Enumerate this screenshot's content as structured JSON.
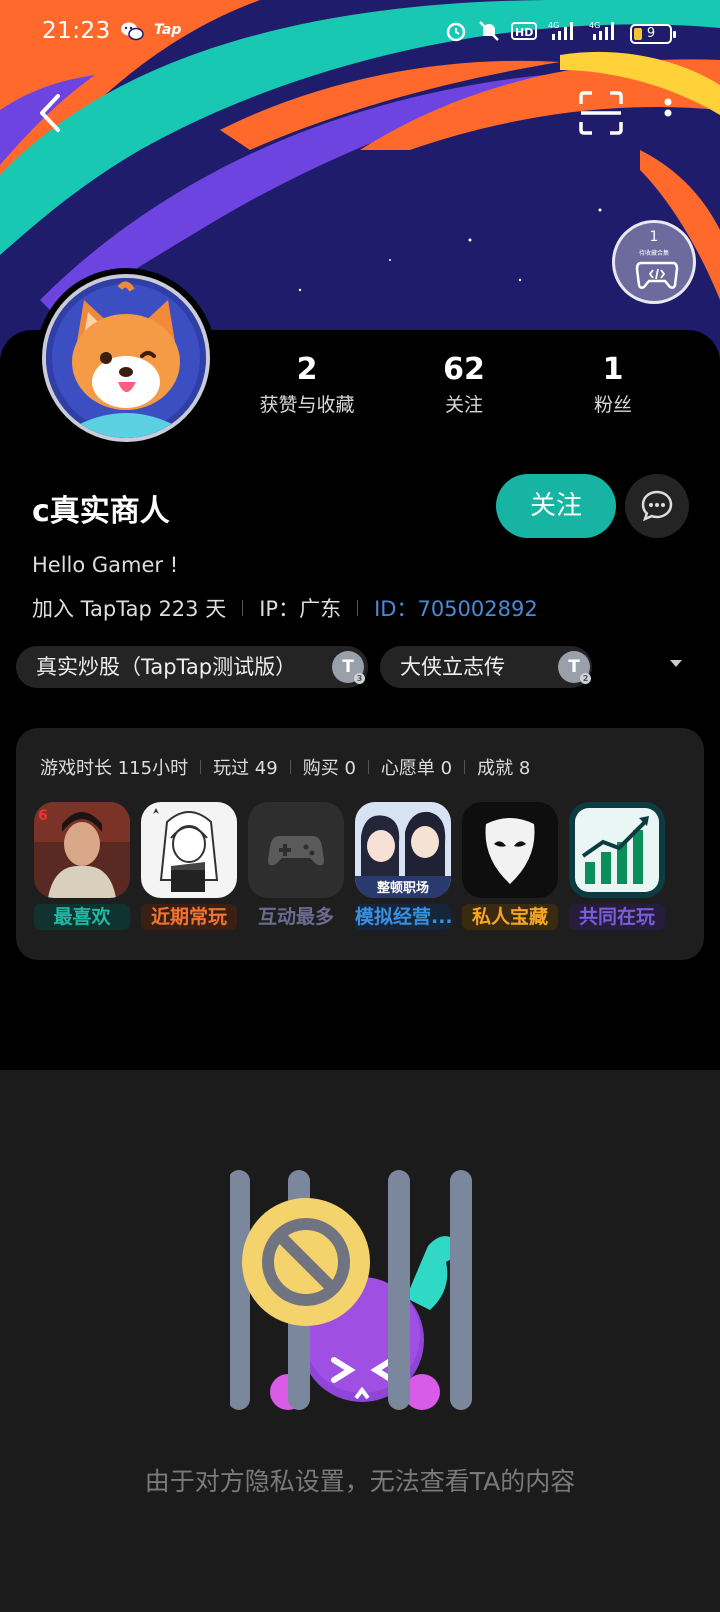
{
  "status_bar": {
    "time": "21:23",
    "tap_label": "Tap",
    "battery": "9"
  },
  "badge": {
    "number": "1",
    "caption": "待收藏合集"
  },
  "stats": [
    {
      "value": "2",
      "label": "获赞与收藏"
    },
    {
      "value": "62",
      "label": "关注"
    },
    {
      "value": "1",
      "label": "粉丝"
    }
  ],
  "profile": {
    "username": "c真实商人",
    "bio": "Hello Gamer !",
    "joined": "加入 TapTap 223 天",
    "ip": "IP：广东",
    "id_label": "ID：",
    "id_value": "705002892"
  },
  "buttons": {
    "follow": "关注"
  },
  "tags": [
    {
      "label": "真实炒股（TapTap测试版）",
      "icon_text": "T",
      "icon_level": "3"
    },
    {
      "label": "大侠立志传",
      "icon_text": "T",
      "icon_level": "2"
    }
  ],
  "games_summary": [
    {
      "text": "游戏时长 115小时"
    },
    {
      "text": "玩过 49"
    },
    {
      "text": "购买 0"
    },
    {
      "text": "心愿单 0"
    },
    {
      "text": "成就 8"
    }
  ],
  "games": [
    {
      "label": "最喜欢",
      "color": "#1fb9a5",
      "bg": "#10332f"
    },
    {
      "label": "近期常玩",
      "color": "#f27430",
      "bg": "#3a2012"
    },
    {
      "label": "互动最多",
      "color": "#6c6a8e",
      "bg": "#1e1e1e"
    },
    {
      "label": "模拟经营...",
      "color": "#3b8fe0",
      "bg": "#15263a",
      "icon_caption": "整顿职场"
    },
    {
      "label": "私人宝藏",
      "color": "#f6a623",
      "bg": "#3a2a10"
    },
    {
      "label": "共同在玩",
      "color": "#7d5bd9",
      "bg": "#261d3d"
    }
  ],
  "privacy": {
    "message": "由于对方隐私设置，无法查看TA的内容"
  },
  "colors": {
    "accent": "#17b3a3",
    "id_link": "#4b8ad8",
    "banner": "#1d1f6e"
  }
}
